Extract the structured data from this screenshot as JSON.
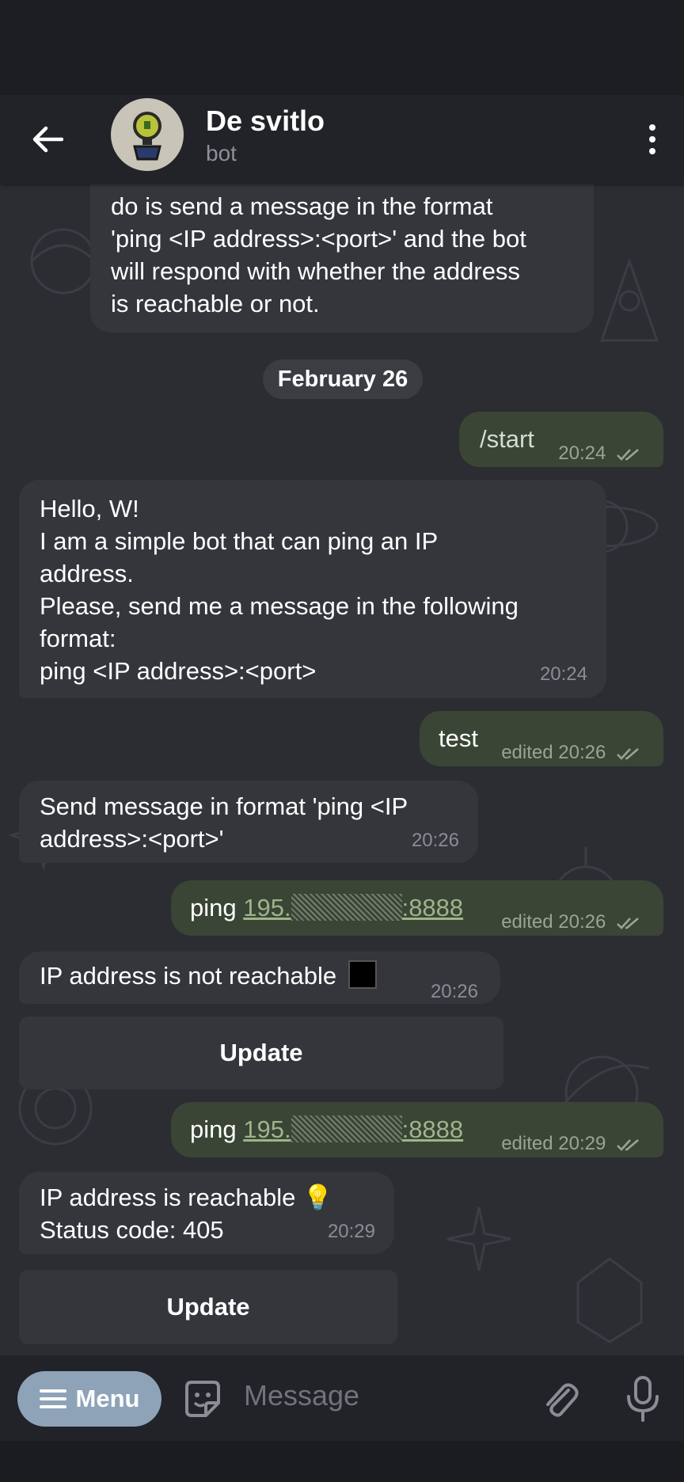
{
  "header": {
    "back_icon": "arrow-left-icon",
    "title": "De svitlo",
    "subtitle": "bot",
    "more_icon": "more-vertical-icon"
  },
  "messages": {
    "intro_partial": {
      "lines": [
        "do is send a message in the format",
        "'ping <IP address>:<port>' and the bot",
        "will respond with whether the address",
        "is reachable or not."
      ]
    },
    "date_divider": "February 26",
    "m1": {
      "text": "/start",
      "time": "20:24"
    },
    "m2": {
      "lines": [
        "Hello, W!",
        "I am a simple bot that can ping an IP",
        "address.",
        "Please, send me a message in the following",
        "format:",
        "ping <IP address>:<port>"
      ],
      "time": "20:24"
    },
    "m3": {
      "text": "test",
      "time": "edited 20:26"
    },
    "m4": {
      "lines": [
        "Send message in format 'ping <IP",
        "address>:<port>'"
      ],
      "time": "20:26"
    },
    "m5": {
      "prefix": "ping ",
      "link_start": "195.",
      "link_end": ":8888",
      "time": "edited 20:26"
    },
    "m6": {
      "text": "IP address is not reachable",
      "emoji": "⬛",
      "time": "20:26"
    },
    "m6_button": "Update",
    "m7": {
      "prefix": "ping ",
      "link_start": "195.",
      "link_end": ":8888",
      "time": "edited 20:29"
    },
    "m8": {
      "lines": [
        "IP address is reachable 💡",
        "Status code: 405"
      ],
      "time": "20:29"
    },
    "m8_button": "Update"
  },
  "input_bar": {
    "menu_label": "Menu",
    "placeholder": "Message",
    "sticker_icon": "sticker-icon",
    "attach_icon": "paperclip-icon",
    "mic_icon": "microphone-icon"
  },
  "colors": {
    "background": "#2b2d32",
    "incoming_bubble": "#34363b",
    "outgoing_bubble": "#3a4535",
    "menu_button": "#8ea3b8",
    "link": "#9eb48b"
  }
}
